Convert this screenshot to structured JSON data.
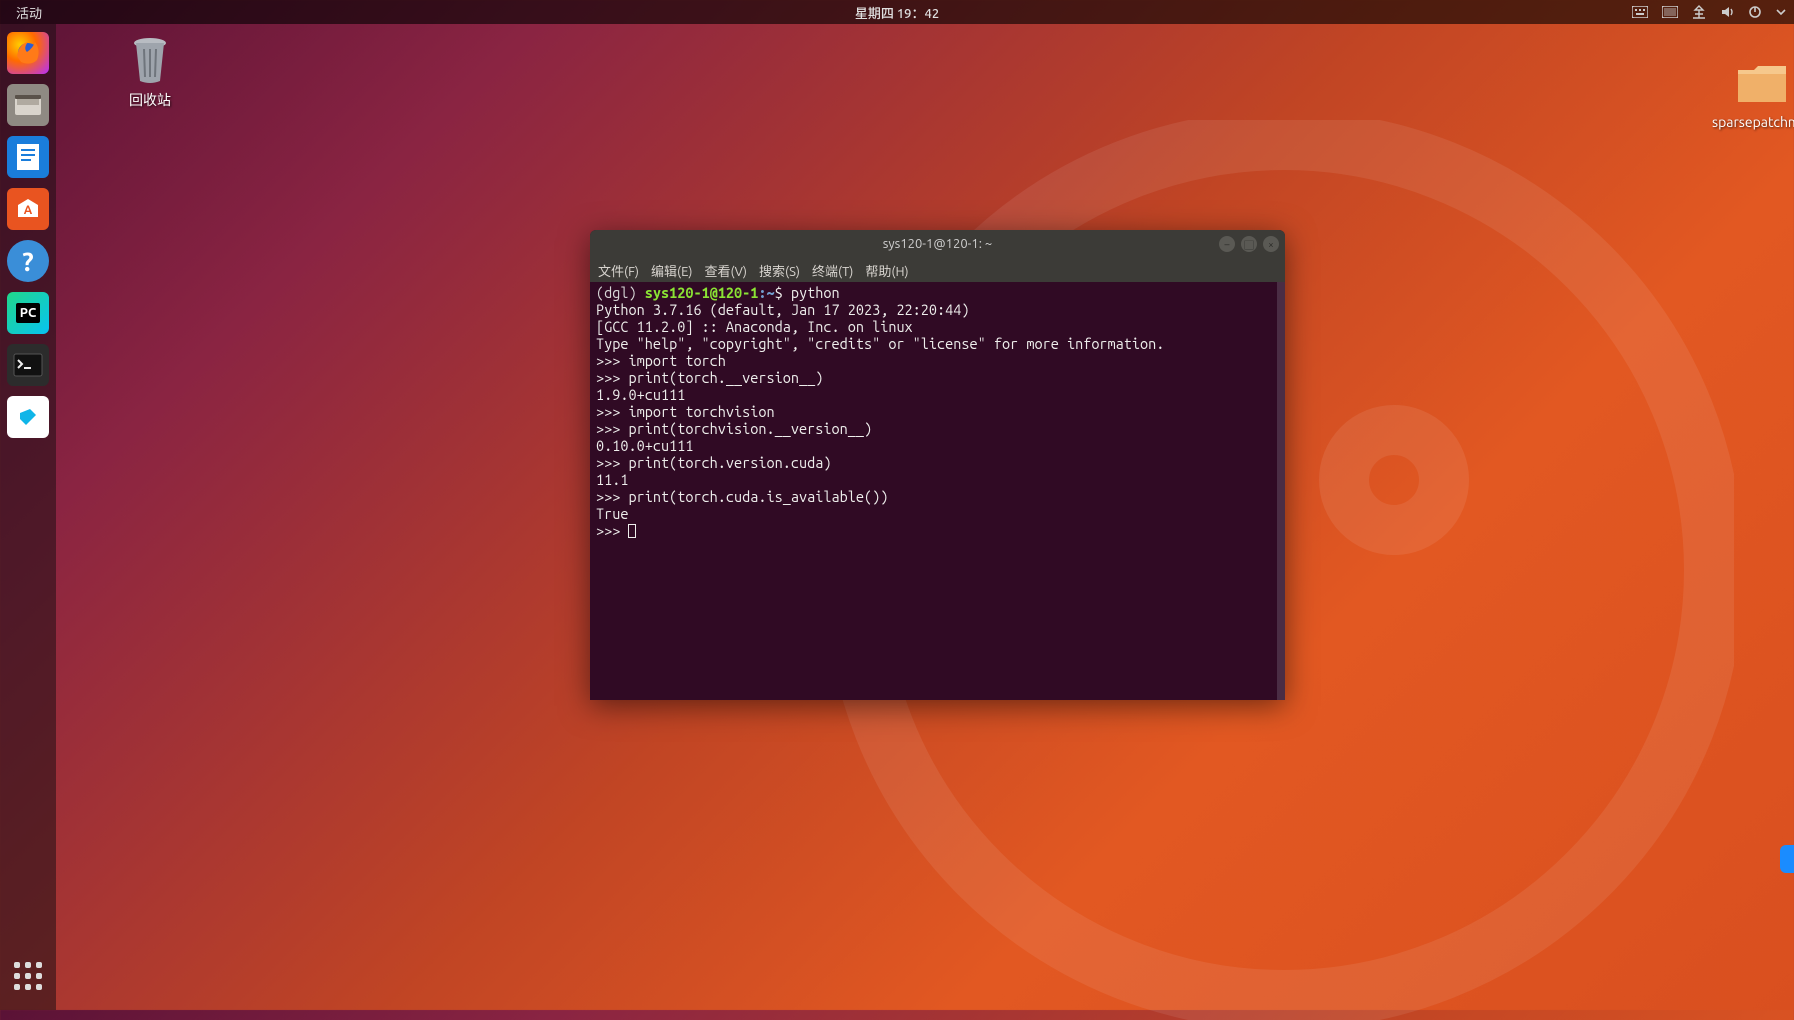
{
  "top_panel": {
    "activities": "活动",
    "clock": "星期四 19：42",
    "tray": {
      "keyboard_icon": "keyboard",
      "battery_icon": "battery",
      "network_icon": "network",
      "volume_icon": "volume",
      "power_icon": "power",
      "dropdown_icon": "chevron-down"
    }
  },
  "dock": {
    "apps": [
      {
        "name": "firefox",
        "label": "Firefox"
      },
      {
        "name": "files",
        "label": "Files"
      },
      {
        "name": "writer",
        "label": "Writer"
      },
      {
        "name": "software",
        "label": "Software"
      },
      {
        "name": "help",
        "label": "Help"
      },
      {
        "name": "pycharm",
        "label": "PyCharm"
      },
      {
        "name": "terminal",
        "label": "Terminal"
      },
      {
        "name": "todesk",
        "label": "ToDesk"
      }
    ],
    "apps_button": "Show Applications"
  },
  "desktop": {
    "trash_label": "回收站",
    "folder_label": "sparsepatchmatch"
  },
  "terminal": {
    "title": "sys120-1@120-1: ~",
    "menu": [
      "文件(F)",
      "编辑(E)",
      "查看(V)",
      "搜索(S)",
      "终端(T)",
      "帮助(H)"
    ],
    "prompt": {
      "env": "(dgl) ",
      "user_host": "sys120-1@120-1",
      "colon_path": ":~",
      "dollar": "$ ",
      "cmd": "python"
    },
    "lines": [
      "Python 3.7.16 (default, Jan 17 2023, 22:20:44)",
      "[GCC 11.2.0] :: Anaconda, Inc. on linux",
      "Type \"help\", \"copyright\", \"credits\" or \"license\" for more information.",
      ">>> import torch",
      ">>> print(torch.__version__)",
      "1.9.0+cu111",
      ">>> import torchvision",
      ">>> print(torchvision.__version__)",
      "0.10.0+cu111",
      ">>> print(torch.version.cuda)",
      "11.1",
      ">>> print(torch.cuda.is_available())",
      "True",
      ">>> "
    ]
  }
}
